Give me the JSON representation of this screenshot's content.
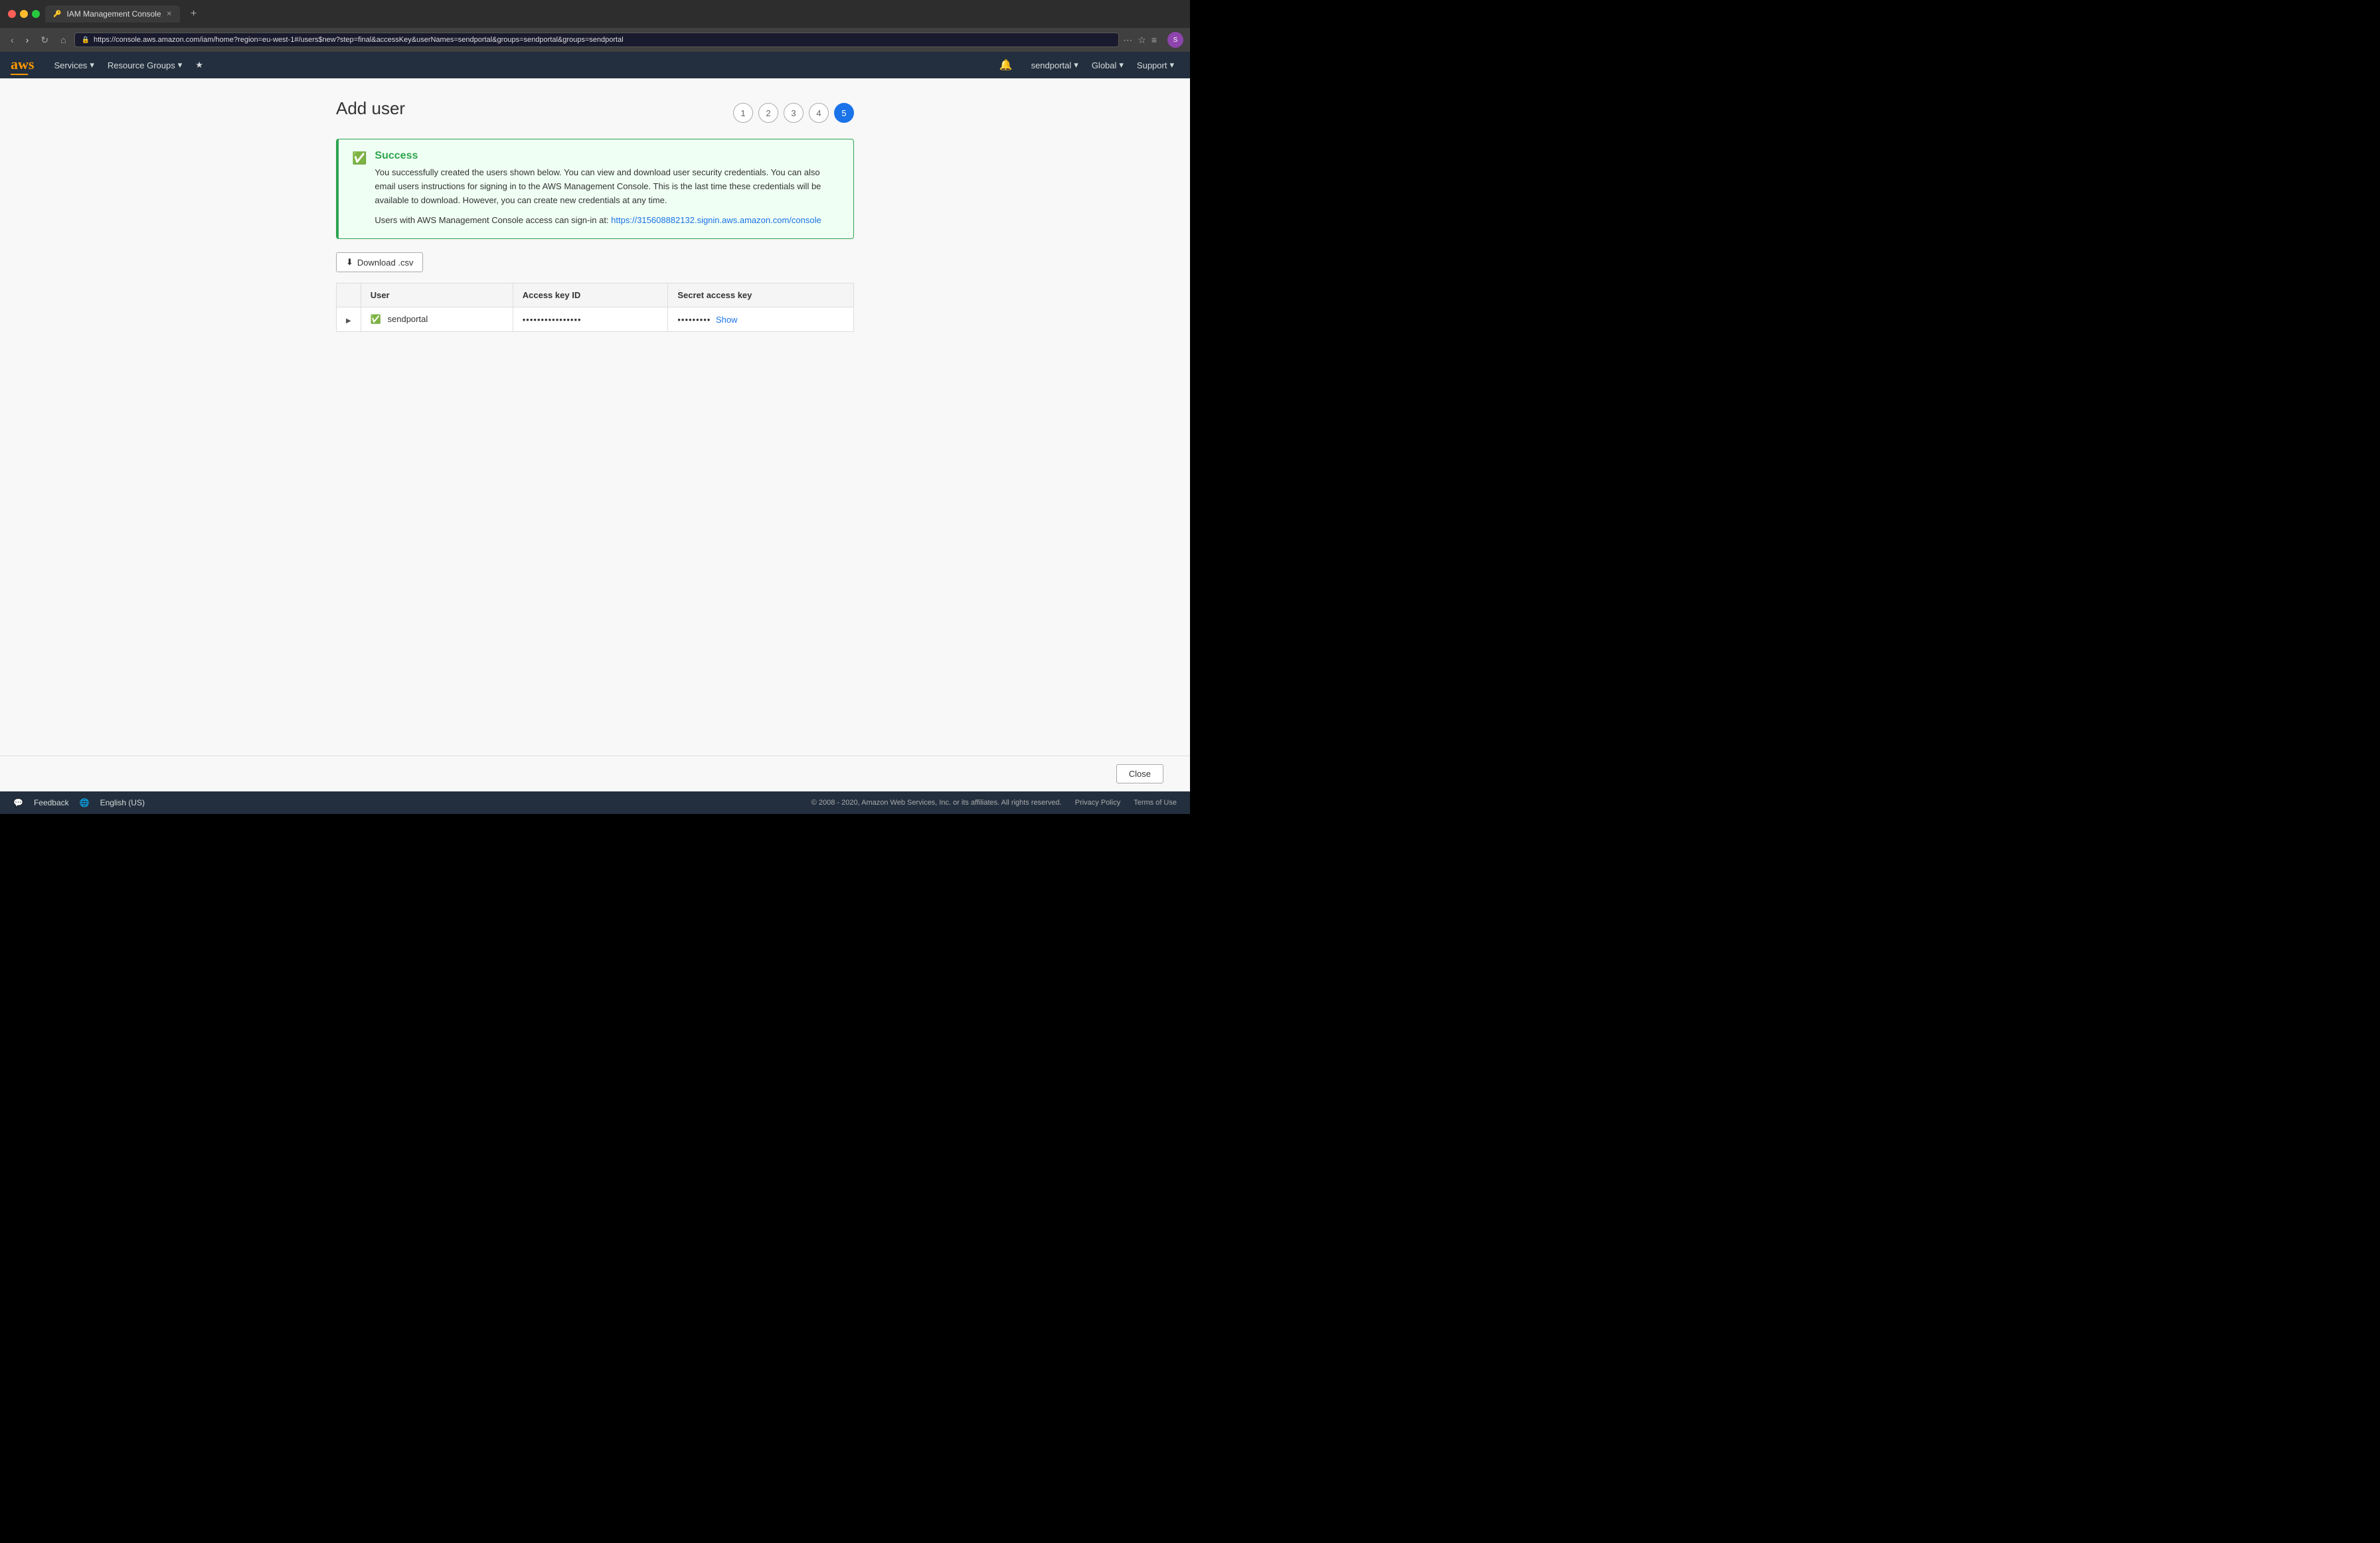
{
  "browser": {
    "tab_title": "IAM Management Console",
    "tab_favicon": "🔑",
    "url": "https://console.aws.amazon.com/iam/home?region=eu-west-1#/users$new?step=final&accessKey&userNames=sendportal&groups=sendportal&groups=sendportal",
    "url_domain": "console.aws.amazon.com",
    "new_tab_icon": "+",
    "back_disabled": false,
    "forward_disabled": true
  },
  "navbar": {
    "services_label": "Services",
    "resource_groups_label": "Resource Groups",
    "bell_icon": "🔔",
    "user_label": "sendportal",
    "region_label": "Global",
    "support_label": "Support",
    "profile_initials": "S"
  },
  "page": {
    "title": "Add user",
    "steps": [
      "1",
      "2",
      "3",
      "4",
      "5"
    ],
    "active_step": 5
  },
  "success_banner": {
    "title": "Success",
    "message": "You successfully created the users shown below. You can view and download user security credentials. You can also email users instructions for signing in to the AWS Management Console. This is the last time these credentials will be available to download. However, you can create new credentials at any time.",
    "signin_prefix": "Users with AWS Management Console access can sign-in at:",
    "signin_url": "https://315608882132.signin.aws.amazon.com/console"
  },
  "download_button": "⬇ Download .csv",
  "table": {
    "col_expand": "",
    "col_user": "User",
    "col_access_key_id": "Access key ID",
    "col_secret_access_key": "Secret access key",
    "rows": [
      {
        "username": "sendportal",
        "access_key_masked": "••••••••••••••••",
        "secret_key_masked": "•••••••••",
        "show_label": "Show"
      }
    ]
  },
  "footer": {
    "close_label": "Close"
  },
  "bottom_bar": {
    "feedback_label": "Feedback",
    "language_label": "English (US)",
    "copyright": "© 2008 - 2020, Amazon Web Services, Inc. or its affiliates. All rights reserved.",
    "privacy_label": "Privacy Policy",
    "terms_label": "Terms of Use"
  }
}
